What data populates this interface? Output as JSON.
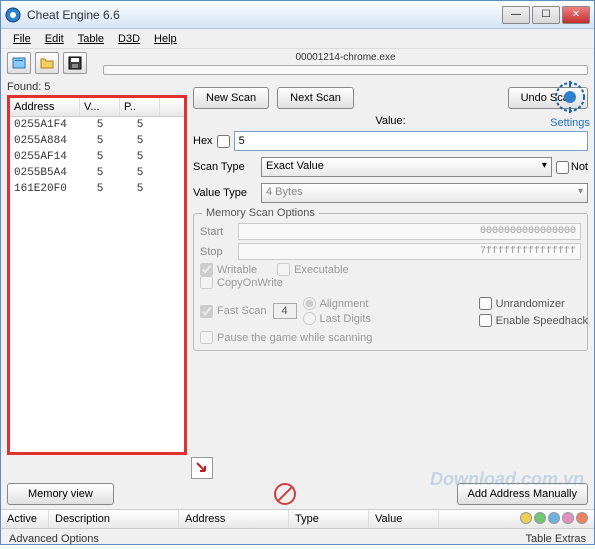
{
  "window": {
    "title": "Cheat Engine 6.6"
  },
  "menu": {
    "file": "File",
    "edit": "Edit",
    "table": "Table",
    "d3d": "D3D",
    "help": "Help"
  },
  "process": {
    "label": "00001214-chrome.exe"
  },
  "found": {
    "label": "Found: 5"
  },
  "table_headers": {
    "address": "Address",
    "value": "V...",
    "prev": "P.."
  },
  "results": [
    {
      "addr": "0255A1F4",
      "v": "5",
      "p": "5"
    },
    {
      "addr": "0255A884",
      "v": "5",
      "p": "5"
    },
    {
      "addr": "0255AF14",
      "v": "5",
      "p": "5"
    },
    {
      "addr": "0255B5A4",
      "v": "5",
      "p": "5"
    },
    {
      "addr": "161E20F0",
      "v": "5",
      "p": "5"
    }
  ],
  "buttons": {
    "new_scan": "New Scan",
    "next_scan": "Next Scan",
    "undo_scan": "Undo Scan",
    "memory_view": "Memory view",
    "add_manual": "Add Address Manually"
  },
  "labels": {
    "value": "Value:",
    "hex": "Hex",
    "scan_type": "Scan Type",
    "value_type": "Value Type",
    "not": "Not",
    "mem_options": "Memory Scan Options",
    "start": "Start",
    "stop": "Stop",
    "writable": "Writable",
    "executable": "Executable",
    "copyonwrite": "CopyOnWrite",
    "fast_scan": "Fast Scan",
    "alignment": "Alignment",
    "last_digits": "Last Digits",
    "pause": "Pause the game while scanning",
    "unrandomizer": "Unrandomizer",
    "speedhack": "Enable Speedhack",
    "settings": "Settings",
    "advanced": "Advanced Options",
    "table_extras": "Table Extras"
  },
  "inputs": {
    "value": "5",
    "scan_type": "Exact Value",
    "value_type": "4 Bytes",
    "start": "0000000000000000",
    "stop": "7fffffffffffffff",
    "fast_scan_val": "4"
  },
  "bottom_headers": {
    "active": "Active",
    "description": "Description",
    "address": "Address",
    "type": "Type",
    "value": "Value"
  },
  "dot_colors": [
    "#f0d050",
    "#70c870",
    "#70b0e0",
    "#e090c0",
    "#f08060"
  ],
  "watermark": "Download.com.vn"
}
